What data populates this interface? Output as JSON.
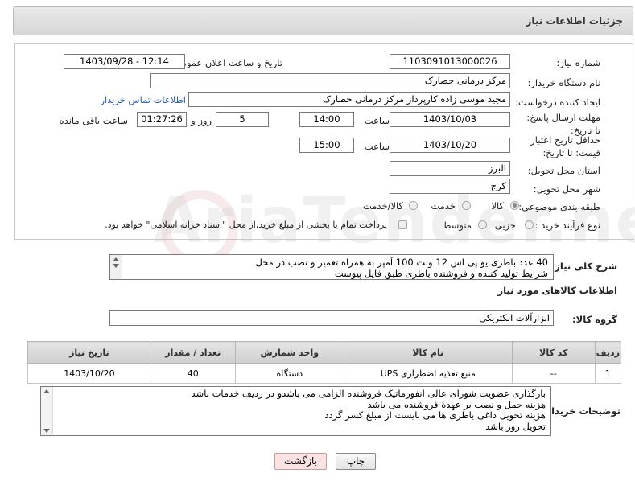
{
  "header": {
    "title": "جزئیات اطلاعات نیاز"
  },
  "form": {
    "need_number_label": "شماره نیاز:",
    "need_number": "1103091013000026",
    "announce_label": "تاریخ و ساعت اعلان عمومی:",
    "announce_value": "1403/09/28 - 12:14",
    "buyer_org_label": "نام دستگاه خریدار:",
    "buyer_org": "مرکز درمانی حصارک",
    "requester_label": "ایجاد کننده درخواست:",
    "requester": "مجید  موسی زاده کارپرداز مرکز درمانی حصارک",
    "contact_link": "اطلاعات تماس خریدار",
    "deadline_label": "مهلت ارسال پاسخ: تا تاریخ:",
    "deadline_date": "1403/10/03",
    "time_word": "ساعت",
    "deadline_time": "14:00",
    "days_value": "5",
    "days_label": "روز و",
    "remaining_time": "01:27:26",
    "remaining_label": "ساعت باقی مانده",
    "validity_label": "حداقل تاریخ اعتبار قیمت: تا تاریخ:",
    "validity_date": "1403/10/20",
    "validity_time": "15:00",
    "province_label": "استان محل تحویل:",
    "province": "البرز",
    "city_label": "شهر محل تحویل:",
    "city": "کرج",
    "category_label": "طبقه بندی موضوعی:",
    "category_options": [
      "کالا",
      "خدمت",
      "کالا/خدمت"
    ],
    "process_label": "نوع فرآیند خرید :",
    "process_options": [
      "جزیی",
      "متوسط"
    ],
    "payment_note": "پرداخت تمام یا بخشی از مبلغ خرید،از محل \"اسناد خزانه اسلامی\" خواهد بود."
  },
  "description": {
    "label": "شرح کلی نیاز:",
    "lines": [
      "40 عدد باطری یو پی اس 12 ولت 100 آمپر به همراه تعمیر و نصب در محل",
      "شرایط تولید کننده و فروشنده باطری طبق فایل پیوست"
    ]
  },
  "goods": {
    "section_title": "اطلاعات کالاهای مورد نیاز",
    "group_label": "گروه کالا:",
    "group_value": "ابزارآلات الکتریکی",
    "columns": [
      "ردیف",
      "کد کالا",
      "نام کالا",
      "واحد شمارش",
      "تعداد / مقدار",
      "تاریخ نیاز"
    ],
    "rows": [
      {
        "row": "1",
        "code": "--",
        "name": "منبع تغذیه اضطراری UPS",
        "unit": "دستگاه",
        "qty": "40",
        "date": "1403/10/20"
      }
    ]
  },
  "buyer_notes": {
    "label": "توضیحات خریدار:",
    "lines": [
      "بارگذاری عضویت شورای عالی انفورماتیک فروشنده الزامی می باشدو در ردیف خدمات باشد",
      "هزینه حمل و نصب بر عهدهٔ فروشنده می باشد",
      "هزینه تحویل داغی باطری ها می بایست از مبلغ کسر گردد",
      "تحویل روز باشد"
    ]
  },
  "buttons": {
    "print": "چاپ",
    "back": "بازگشت"
  },
  "colors": {
    "link": "#2a5db0",
    "back_button_bg": "#fbe3e3",
    "header_bg": "#dcdcdc"
  }
}
